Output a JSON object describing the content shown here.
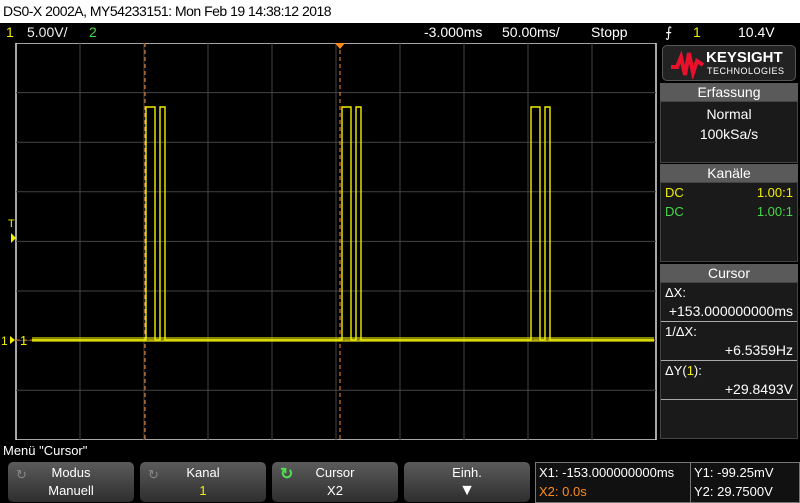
{
  "title": "DS0-X 2002A, MY54233151: Mon Feb 19 14:38:12 2018",
  "topbar": {
    "ch1": "1",
    "ch1_scale": "5.00V/",
    "ch2": "2",
    "delay": "-3.000ms",
    "timebase": "50.00ms/",
    "run_state": "Stopp",
    "trigger_icon": "rising-edge",
    "trigger_source": "1",
    "trigger_level": "10.4V"
  },
  "brand": {
    "name": "KEYSIGHT",
    "sub": "TECHNOLOGIES",
    "color": "#e8102a"
  },
  "acquisition": {
    "header": "Erfassung",
    "mode": "Normal",
    "rate": "100kSa/s"
  },
  "channels": {
    "header": "Kanäle",
    "rows": [
      {
        "coupling": "DC",
        "probe": "1.00:1",
        "color": "#f2f000"
      },
      {
        "coupling": "DC",
        "probe": "1.00:1",
        "color": "#46d846"
      }
    ]
  },
  "cursor_panel": {
    "header": "Cursor",
    "dx_label": "ΔX:",
    "dx": "+153.000000000ms",
    "inv_label": "1/ΔX:",
    "inv": "+6.5359Hz",
    "dy_label_pre": "ΔY(",
    "dy_ch": "1",
    "dy_label_post": "):",
    "dy": "+29.8493V"
  },
  "markers": {
    "trigger": "T",
    "ground": "1",
    "ch_label": "1"
  },
  "menu_label": "Menü \"Cursor\"",
  "softkeys": [
    {
      "top": "Modus",
      "bottom": "Manuell"
    },
    {
      "top": "Kanal",
      "bottom": "1"
    },
    {
      "top": "Cursor",
      "bottom": "X2"
    },
    {
      "top": "Einh.",
      "bottom": "▼"
    }
  ],
  "readout": {
    "x1": "X1: -153.000000000ms",
    "x2": "X2: 0.0s",
    "y1": "Y1: -99.25mV",
    "y2": "Y2: 29.7500V"
  }
}
